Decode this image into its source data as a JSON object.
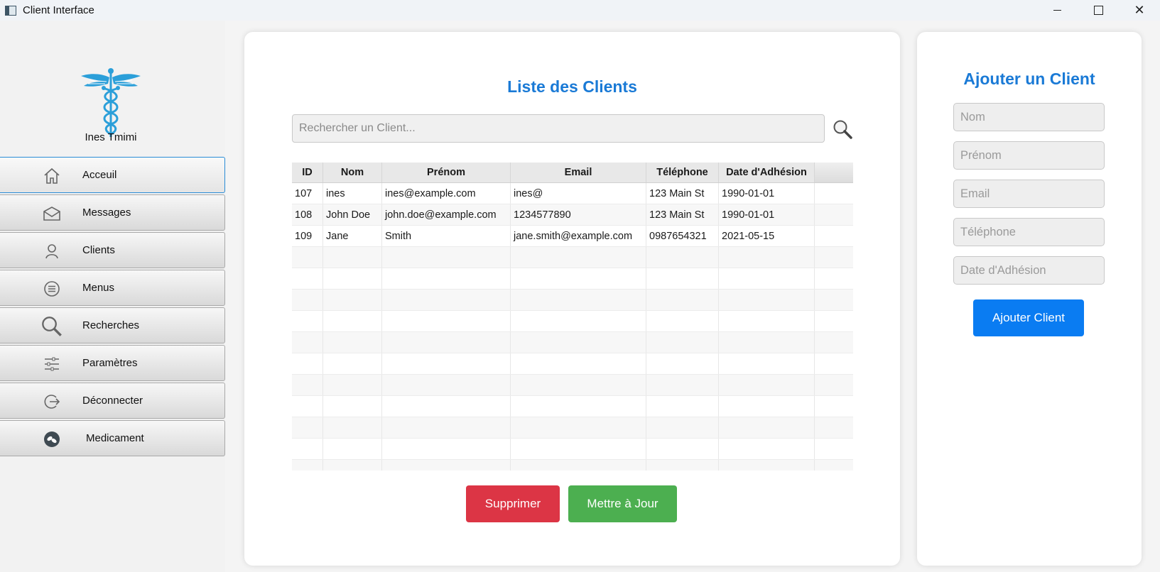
{
  "window": {
    "title": "Client Interface"
  },
  "sidebar": {
    "user_name": "Ines Tmimi",
    "items": [
      {
        "label": "Acceuil",
        "icon": "home-icon"
      },
      {
        "label": "Messages",
        "icon": "envelope-icon"
      },
      {
        "label": "Clients",
        "icon": "user-icon"
      },
      {
        "label": "Menus",
        "icon": "menu-icon"
      },
      {
        "label": "Recherches",
        "icon": "search-icon"
      },
      {
        "label": "Paramètres",
        "icon": "sliders-icon"
      },
      {
        "label": "Déconnecter",
        "icon": "logout-icon"
      },
      {
        "label": "Medicament",
        "icon": "pills-icon"
      }
    ]
  },
  "clients_panel": {
    "title": "Liste des Clients",
    "search_placeholder": "Rechercher un Client...",
    "columns": [
      "ID",
      "Nom",
      "Prénom",
      "Email",
      "Téléphone",
      "Date d'Adhésion"
    ],
    "rows": [
      [
        "107",
        "ines",
        "ines@example.com",
        "ines@",
        "123 Main St",
        "1990-01-01"
      ],
      [
        "108",
        "John Doe",
        "john.doe@example.com",
        "1234577890",
        "123 Main St",
        "1990-01-01"
      ],
      [
        "109",
        "Jane",
        "Smith",
        "jane.smith@example.com",
        "0987654321",
        "2021-05-15"
      ]
    ],
    "delete_label": "Supprimer",
    "update_label": "Mettre à Jour"
  },
  "add_panel": {
    "title": "Ajouter un Client",
    "placeholders": {
      "nom": "Nom",
      "prenom": "Prénom",
      "email": "Email",
      "telephone": "Téléphone",
      "date": "Date d'Adhésion"
    },
    "submit_label": "Ajouter Client"
  },
  "colors": {
    "accent": "#1a7ad6",
    "delete": "#dc3545",
    "update": "#4caf50",
    "add": "#0a7cf2",
    "active_border": "#2a8cd6"
  }
}
